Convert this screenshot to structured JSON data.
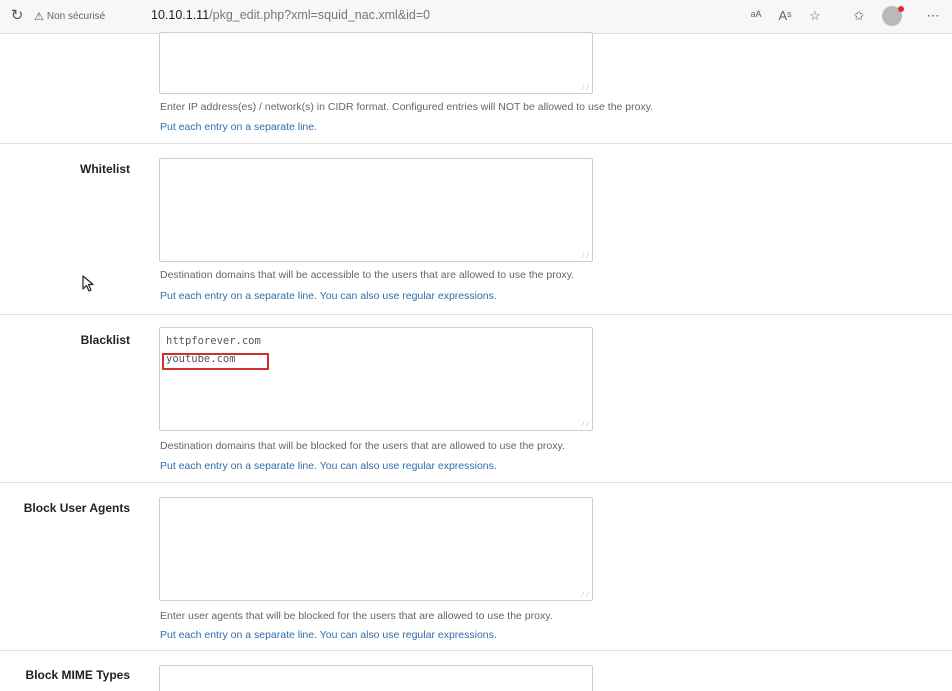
{
  "browser": {
    "security_label": "Non sécurisé",
    "url_host": "10.10.1.11",
    "url_path": "/pkg_edit.php?xml=squid_nac.xml&id=0",
    "icons": [
      "reload-icon",
      "warning-icon",
      "read-aloud-icon",
      "text-size-icon",
      "favorite-icon",
      "collections-icon",
      "profile-icon",
      "more-icon"
    ]
  },
  "rows": {
    "allowed_subnets": {
      "help1": "Enter IP address(es) / network(s) in CIDR format. Configured entries will NOT be allowed to use the proxy.",
      "help2": "Put each entry on a separate line."
    },
    "whitelist": {
      "label": "Whitelist",
      "help1": "Destination domains that will be accessible to the users that are allowed to use the proxy.",
      "help2": "Put each entry on a separate line. You can also use regular expressions."
    },
    "blacklist": {
      "label": "Blacklist",
      "entries": [
        "httpforever.com",
        "youtube.com"
      ],
      "help1": "Destination domains that will be blocked for the users that are allowed to use the proxy.",
      "help2": "Put each entry on a separate line. You can also use regular expressions."
    },
    "block_user_agents": {
      "label": "Block User Agents",
      "help1": "Enter user agents that will be blocked for the users that are allowed to use the proxy.",
      "help2": "Put each entry on a separate line. You can also use regular expressions."
    },
    "block_mime_types": {
      "label": "Block MIME Types"
    }
  },
  "highlight_color": "#d0312d"
}
